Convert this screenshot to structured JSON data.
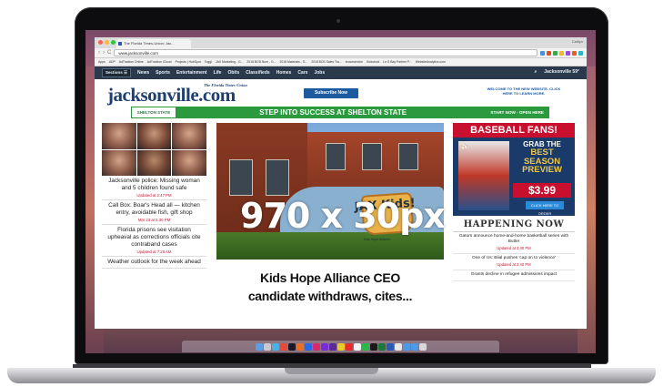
{
  "browser": {
    "tab_title": "The Florida Times-Union: Jac...",
    "user": "Caitlyn",
    "url": "www.jacksonville.com",
    "nav_back": "‹",
    "nav_forward": "›",
    "nav_reload": "C",
    "bookmarks": [
      "Apps",
      "ADP",
      "AdTraction Online",
      "AdTraction iCloud",
      "Projects | HubSpot",
      "Toggl",
      "JAX Marketing - G...",
      "2018 BCB Num - G...",
      "2018 Materials - G...",
      "2018 BCB Sales Tra...",
      "bruceservice",
      "Kickstock",
      "Le S Bay Partner P...",
      "WebsiteAnalytics.com"
    ]
  },
  "site": {
    "topnav": {
      "sections": "Sections ☰",
      "items": [
        "News",
        "Sports",
        "Entertainment",
        "Life",
        "Obits",
        "Classifieds",
        "Homes",
        "Cars",
        "Jobs"
      ],
      "search_icon": "search-icon",
      "weather": "Jacksonville 59°"
    },
    "logo": "jacksonville.com",
    "tagline": "The Florida Times-Union",
    "subscribe": "Subscribe Now",
    "promo": "WELCOME TO THE NEW WEBSITE. CLICK HERE TO LEARN MORE."
  },
  "banner_ad": {
    "brand": "SHELTON STATE",
    "text": "STEP INTO SUCCESS AT SHELTON STATE",
    "cta": "START NOW - OPEN HERE",
    "color": "#2b9a3e"
  },
  "overlay_label": "970 x 30px",
  "left_stories": [
    {
      "headline": "Jacksonville police: Missing woman and 5 children found safe",
      "time": "Updated at 2:47 PM"
    },
    {
      "headline": "Call Box: Boar's Head all — kitchen entry, avoidable fish, gift shop",
      "time": "Mar 23 at 5:30 PM"
    },
    {
      "headline": "Florida prisons see visitation upheaval as corrections officials cite contraband cases",
      "time": "Updated at 7:25 AM"
    },
    {
      "headline": "Weather outlook for the week ahead",
      "time": ""
    }
  ],
  "main_story": {
    "sign_text": "JAX Kids!",
    "sign_sub": "Kids Hope Alliance",
    "headline_line1": "Kids Hope Alliance CEO",
    "headline_line2": "candidate withdraws, cites..."
  },
  "right_ad": {
    "top": "BASEBALL FANS!",
    "copy1": "GRAB THE",
    "copy2": "BEST SEASON PREVIEW",
    "price": "$3.99",
    "cta": "CLICK HERE TO ORDER"
  },
  "happening_now": {
    "title": "HAPPENING NOW",
    "items": [
      {
        "headline": "Gators announce home-and-home basketball series with Butler",
        "time": "Updated at 3:40 PM"
      },
      {
        "headline": "One of Us: Bilal pushes 'cap on to violence'",
        "time": "Updated at 3:40 PM"
      },
      {
        "headline": "Grants decline in refugee admissions impact",
        "time": ""
      }
    ]
  }
}
